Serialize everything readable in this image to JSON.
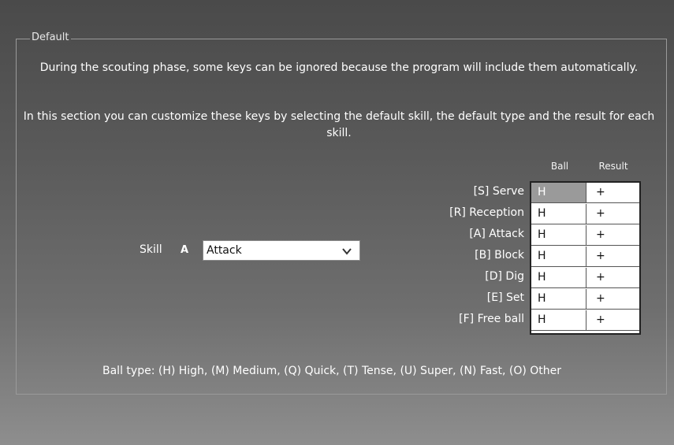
{
  "group_title": "Default",
  "paragraph1": "During the scouting phase, some keys can be ignored because the program will include them automatically.",
  "paragraph2": "In this section you can customize these keys by selecting the default skill, the default type and the result for each skill.",
  "skill": {
    "label": "Skill",
    "key": "A",
    "selected": "Attack"
  },
  "table": {
    "headers": {
      "ball": "Ball",
      "result": "Result"
    },
    "rows": [
      {
        "label": "[S] Serve",
        "ball": "H",
        "result": "+"
      },
      {
        "label": "[R] Reception",
        "ball": "H",
        "result": "+"
      },
      {
        "label": "[A] Attack",
        "ball": "H",
        "result": "+"
      },
      {
        "label": "[B] Block",
        "ball": "H",
        "result": "+"
      },
      {
        "label": "[D] Dig",
        "ball": "H",
        "result": "+"
      },
      {
        "label": "[E] Set",
        "ball": "H",
        "result": "+"
      },
      {
        "label": "[F] Free ball",
        "ball": "H",
        "result": "+"
      }
    ]
  },
  "footer_text": "Ball type: (H) High, (M) Medium, (Q) Quick, (T) Tense, (U) Super, (N) Fast, (O) Other",
  "colors": {
    "selected_cell": "#9a9a9a"
  }
}
